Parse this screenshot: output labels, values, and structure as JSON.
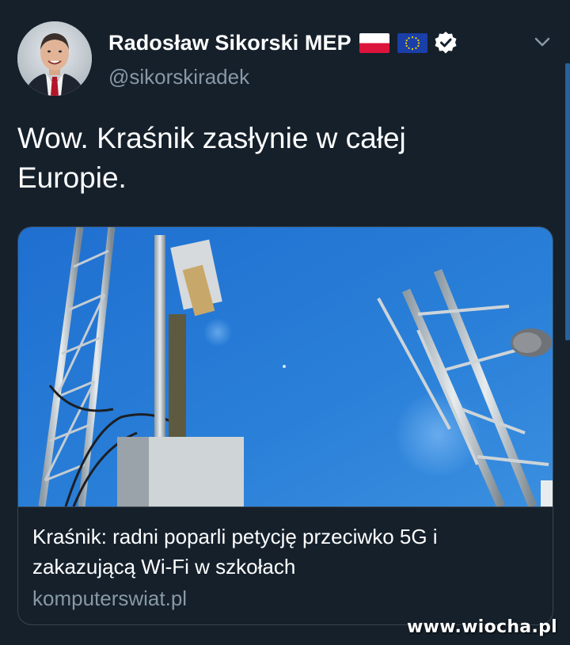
{
  "author": {
    "display_name": "Radosław Sikorski MEP",
    "handle": "@sikorskiradek",
    "flags": [
      "poland-flag-icon",
      "eu-flag-icon"
    ],
    "verified_icon": "verified-badge-icon",
    "avatar_icon": "profile-photo"
  },
  "menu": {
    "icon": "chevron-down-icon"
  },
  "tweet": {
    "text_line1": "Wow. Kraśnik zasłynie w całej",
    "text_line2": "Europie."
  },
  "card": {
    "image_icon": "cell-towers-photo",
    "title_line1": "Kraśnik: radni poparli petycję przeciwko 5G i",
    "title_line2": "zakazującą Wi-Fi w szkołach",
    "domain": "komputerswiat.pl"
  },
  "watermark": {
    "text": "www.wiocha.pl"
  },
  "colors": {
    "background": "#15202b",
    "secondary_text": "#8899a6",
    "border": "#38444d",
    "sky": "#2a80d8"
  }
}
